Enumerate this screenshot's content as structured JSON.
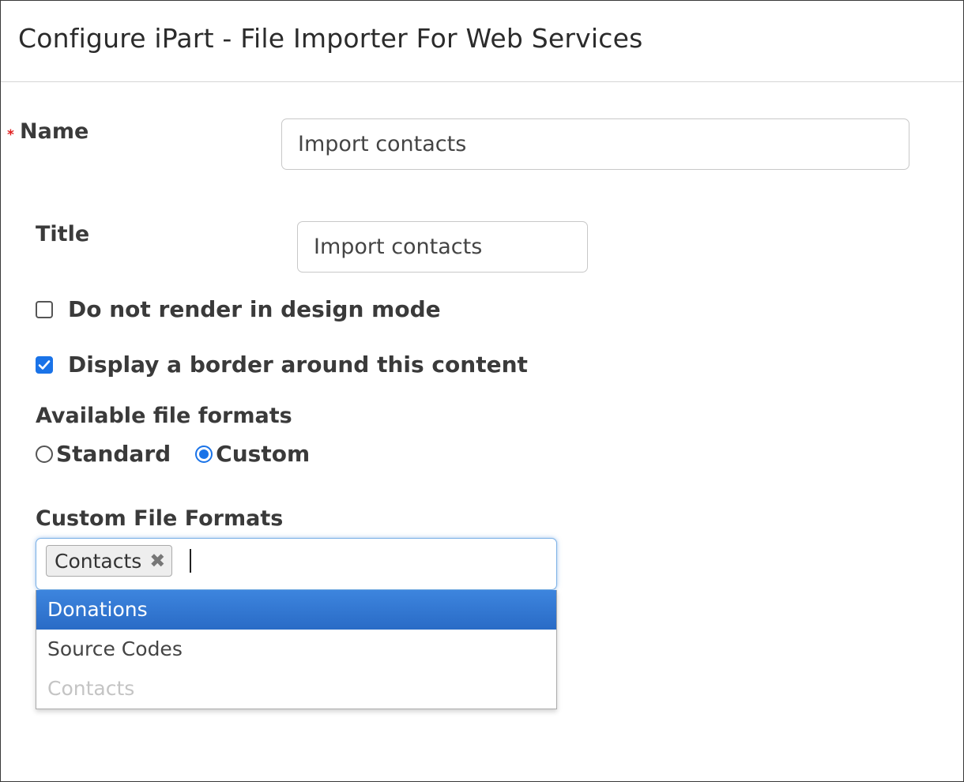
{
  "dialog": {
    "title": "Configure iPart - File Importer For Web Services"
  },
  "form": {
    "required_mark": "*",
    "name": {
      "label": "Name",
      "value": "Import contacts"
    },
    "title": {
      "label": "Title",
      "value": "Import contacts"
    },
    "design_mode": {
      "label": "Do not render in design mode",
      "checked": false
    },
    "border": {
      "label": "Display a border around this content",
      "checked": true
    },
    "file_formats": {
      "label": "Available file formats",
      "options": [
        {
          "label": "Standard",
          "selected": false
        },
        {
          "label": "Custom",
          "selected": true
        }
      ]
    },
    "custom_formats": {
      "label": "Custom File Formats",
      "selected_tags": [
        "Contacts"
      ],
      "tag_remove_icon": "close-icon",
      "dropdown_options": [
        {
          "label": "Donations",
          "state": "highlighted"
        },
        {
          "label": "Source Codes",
          "state": "normal"
        },
        {
          "label": "Contacts",
          "state": "disabled"
        }
      ]
    }
  },
  "colors": {
    "accent": "#1a73e8",
    "highlight": "#2f74d0",
    "required": "#e02020"
  }
}
